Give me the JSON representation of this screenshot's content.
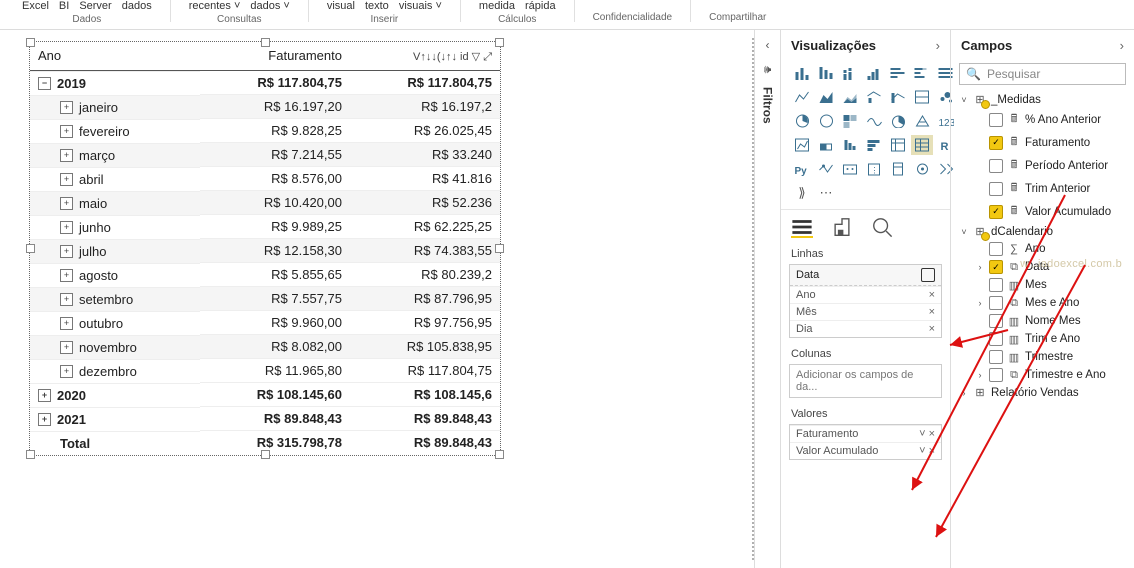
{
  "ribbon": {
    "g1": {
      "items": [
        "Excel",
        "BI",
        "Server",
        "dados"
      ],
      "label": "Dados"
    },
    "g2": {
      "items": [
        "recentes ˅",
        "dados ˅"
      ],
      "label": "Consultas"
    },
    "g3": {
      "items": [
        "visual",
        "texto",
        "visuais ˅"
      ],
      "label": "Inserir"
    },
    "g4": {
      "items": [
        "medida",
        "rápida"
      ],
      "label": "Cálculos"
    },
    "g5": {
      "items": [],
      "label": "Confidencialidade"
    },
    "g6": {
      "items": [],
      "label": "Compartilhar"
    }
  },
  "matrix": {
    "headers": {
      "c1": "Ano",
      "c2": "Faturamento",
      "c3_raw": "V↑↓↓(↓↑↓ id ▽ ⤢"
    },
    "years": [
      {
        "name": "2019",
        "fat": "R$ 117.804,75",
        "acc": "R$ 117.804,75",
        "expanded": true,
        "months": [
          [
            "janeiro",
            "R$ 16.197,20",
            "R$ 16.197,2"
          ],
          [
            "fevereiro",
            "R$ 9.828,25",
            "R$ 26.025,45"
          ],
          [
            "março",
            "R$ 7.214,55",
            "R$ 33.240"
          ],
          [
            "abril",
            "R$ 8.576,00",
            "R$ 41.816"
          ],
          [
            "maio",
            "R$ 10.420,00",
            "R$ 52.236"
          ],
          [
            "junho",
            "R$ 9.989,25",
            "R$ 62.225,25"
          ],
          [
            "julho",
            "R$ 12.158,30",
            "R$ 74.383,55"
          ],
          [
            "agosto",
            "R$ 5.855,65",
            "R$ 80.239,2"
          ],
          [
            "setembro",
            "R$ 7.557,75",
            "R$ 87.796,95"
          ],
          [
            "outubro",
            "R$ 9.960,00",
            "R$ 97.756,95"
          ],
          [
            "novembro",
            "R$ 8.082,00",
            "R$ 105.838,95"
          ],
          [
            "dezembro",
            "R$ 11.965,80",
            "R$ 117.804,75"
          ]
        ]
      },
      {
        "name": "2020",
        "fat": "R$ 108.145,60",
        "acc": "R$ 108.145,6",
        "expanded": false
      },
      {
        "name": "2021",
        "fat": "R$ 89.848,43",
        "acc": "R$ 89.848,43",
        "expanded": false
      }
    ],
    "total": {
      "label": "Total",
      "fat": "R$ 315.798,78",
      "acc": "R$ 89.848,43"
    }
  },
  "filters": {
    "chev": "‹",
    "label": "Filtros"
  },
  "viz_pane": {
    "title": "Visualizações",
    "tabs_section": "",
    "wells": {
      "linhas": "Linhas",
      "colunas": "Colunas",
      "valores": "Valores",
      "rows_field": "Data",
      "rows_children": [
        "Ano",
        "Mês",
        "Dia"
      ],
      "cols_placeholder": "Adicionar os campos de da...",
      "values_items": [
        "Faturamento",
        "Valor Acumulado"
      ]
    }
  },
  "fields_pane": {
    "title": "Campos",
    "search_placeholder": "Pesquisar",
    "tables": [
      {
        "name": "_Medidas",
        "expanded": true,
        "badge": true,
        "fields": [
          {
            "name": "% Ano Anterior",
            "checked": false,
            "icon": "calc"
          },
          {
            "name": "Faturamento",
            "checked": true,
            "icon": "calc"
          },
          {
            "name": "Período Anterior",
            "checked": false,
            "icon": "calc"
          },
          {
            "name": "Trim Anterior",
            "checked": false,
            "icon": "calc"
          },
          {
            "name": "Valor Acumulado",
            "checked": true,
            "icon": "calc"
          }
        ]
      },
      {
        "name": "dCalendario",
        "expanded": true,
        "badge": true,
        "fields": [
          {
            "name": "Ano",
            "checked": false,
            "icon": "sigma"
          },
          {
            "name": "Data",
            "checked": true,
            "icon": "hier",
            "caret": true
          },
          {
            "name": "Mes",
            "checked": false,
            "icon": "col"
          },
          {
            "name": "Mes e Ano",
            "checked": false,
            "icon": "hier",
            "caret": true
          },
          {
            "name": "Nome Mes",
            "checked": false,
            "icon": "col"
          },
          {
            "name": "Trim e Ano",
            "checked": false,
            "icon": "col"
          },
          {
            "name": "Trimestre",
            "checked": false,
            "icon": "col"
          },
          {
            "name": "Trimestre e Ano",
            "checked": false,
            "icon": "hier",
            "caret": true
          }
        ]
      },
      {
        "name": "Relatório Vendas",
        "expanded": false,
        "badge": false
      }
    ]
  },
  "watermark": "w...iadoexcel.com.b",
  "chart_data": {
    "type": "table",
    "title": "Matrix: Faturamento / Valor Acumulado por Ano > Mês",
    "columns": [
      "Ano/Mês",
      "Faturamento",
      "Valor Acumulado"
    ],
    "rows": [
      [
        "2019",
        117804.75,
        117804.75
      ],
      [
        "2019 / janeiro",
        16197.2,
        16197.2
      ],
      [
        "2019 / fevereiro",
        9828.25,
        26025.45
      ],
      [
        "2019 / março",
        7214.55,
        33240
      ],
      [
        "2019 / abril",
        8576.0,
        41816
      ],
      [
        "2019 / maio",
        10420.0,
        52236
      ],
      [
        "2019 / junho",
        9989.25,
        62225.25
      ],
      [
        "2019 / julho",
        12158.3,
        74383.55
      ],
      [
        "2019 / agosto",
        5855.65,
        80239.2
      ],
      [
        "2019 / setembro",
        7557.75,
        87796.95
      ],
      [
        "2019 / outubro",
        9960.0,
        97756.95
      ],
      [
        "2019 / novembro",
        8082.0,
        105838.95
      ],
      [
        "2019 / dezembro",
        11965.8,
        117804.75
      ],
      [
        "2020",
        108145.6,
        108145.6
      ],
      [
        "2021",
        89848.43,
        89848.43
      ],
      [
        "Total",
        315798.78,
        89848.43
      ]
    ]
  }
}
